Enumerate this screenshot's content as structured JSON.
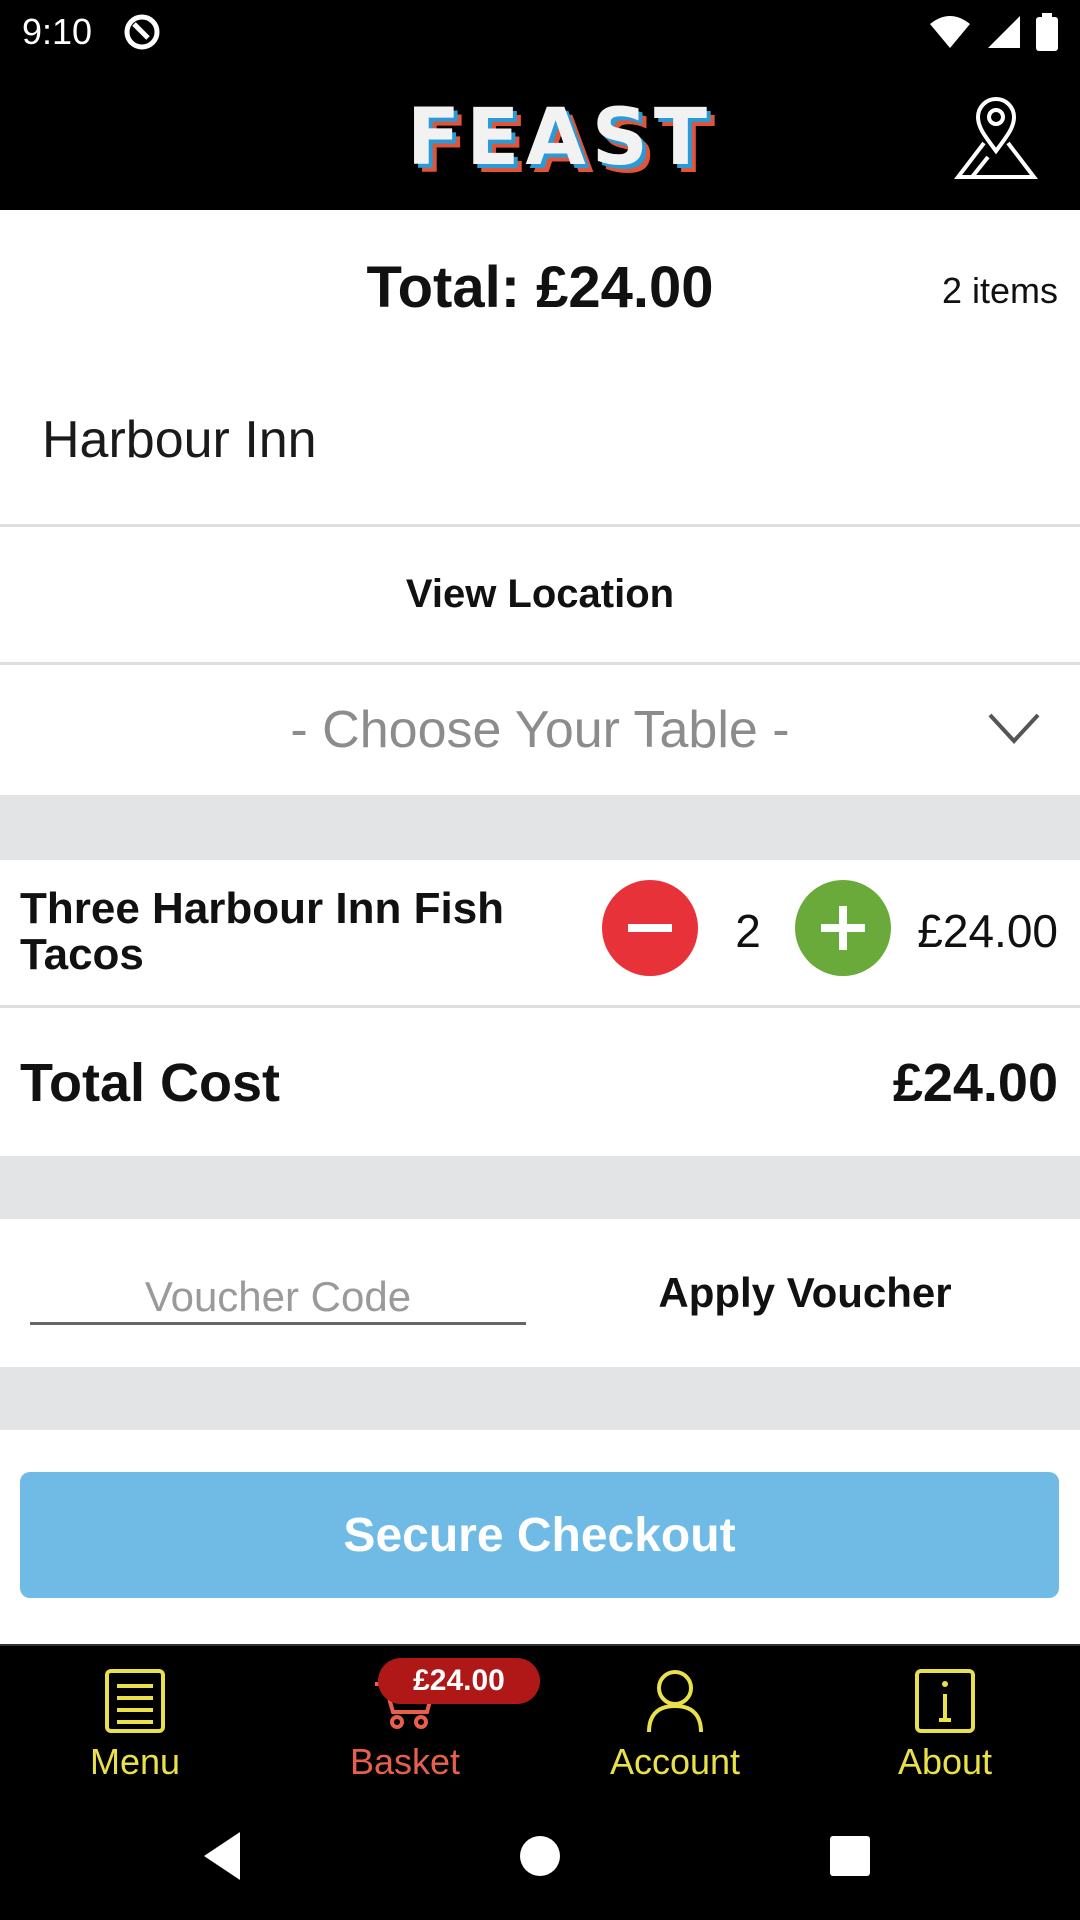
{
  "status_bar": {
    "time": "9:10",
    "icons": [
      "app-notification-icon",
      "wifi-icon",
      "signal-icon",
      "battery-icon"
    ]
  },
  "header": {
    "logo_text": "FEAST",
    "location_icon": "location-pin-icon"
  },
  "summary": {
    "total_heading": "Total: £24.00",
    "item_count": "2 items"
  },
  "venue": {
    "name": "Harbour Inn",
    "view_location_label": "View Location",
    "table_select_placeholder": "- Choose Your Table -"
  },
  "basket": {
    "items": [
      {
        "name": "Three Harbour Inn Fish Tacos",
        "quantity": "2",
        "price": "£24.00"
      }
    ],
    "total_cost_label": "Total Cost",
    "total_cost_value": "£24.00"
  },
  "voucher": {
    "placeholder": "Voucher Code",
    "value": "",
    "apply_label": "Apply Voucher"
  },
  "checkout": {
    "label": "Secure Checkout"
  },
  "bottom_nav": {
    "items": [
      {
        "label": "Menu",
        "icon": "menu-icon",
        "active": false
      },
      {
        "label": "Basket",
        "icon": "basket-icon",
        "active": true,
        "badge": "£24.00"
      },
      {
        "label": "Account",
        "icon": "account-icon",
        "active": false
      },
      {
        "label": "About",
        "icon": "info-icon",
        "active": false
      }
    ]
  },
  "colors": {
    "accent_yellow": "#e9e04a",
    "active_red": "#e8604c",
    "minus_red": "#e8323a",
    "plus_green": "#6aaa3a",
    "checkout_blue": "#6fbbe5",
    "badge_red": "#b01818",
    "band_gray": "#e3e4e6"
  }
}
